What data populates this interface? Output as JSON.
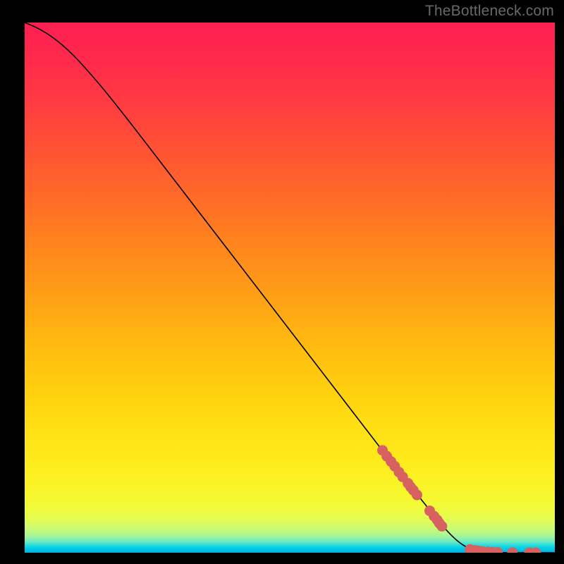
{
  "watermark": "TheBottleneck.com",
  "chart_data": {
    "type": "line",
    "title": "",
    "xlabel": "",
    "ylabel": "",
    "xlim": [
      0,
      100
    ],
    "ylim": [
      0,
      100
    ],
    "grid": false,
    "legend": false,
    "curve": [
      {
        "x": 0.0,
        "y": 100.0
      },
      {
        "x": 2.0,
        "y": 99.2
      },
      {
        "x": 4.0,
        "y": 98.1
      },
      {
        "x": 6.0,
        "y": 96.7
      },
      {
        "x": 8.0,
        "y": 95.0
      },
      {
        "x": 10.0,
        "y": 93.0
      },
      {
        "x": 12.0,
        "y": 90.8
      },
      {
        "x": 14.5,
        "y": 87.9
      },
      {
        "x": 17.0,
        "y": 84.8
      },
      {
        "x": 20.0,
        "y": 81.0
      },
      {
        "x": 25.0,
        "y": 74.5
      },
      {
        "x": 30.0,
        "y": 68.0
      },
      {
        "x": 35.0,
        "y": 61.5
      },
      {
        "x": 40.0,
        "y": 55.0
      },
      {
        "x": 45.0,
        "y": 48.5
      },
      {
        "x": 50.0,
        "y": 42.0
      },
      {
        "x": 55.0,
        "y": 35.5
      },
      {
        "x": 60.0,
        "y": 29.0
      },
      {
        "x": 65.0,
        "y": 22.5
      },
      {
        "x": 70.0,
        "y": 16.0
      },
      {
        "x": 75.0,
        "y": 9.8
      },
      {
        "x": 78.0,
        "y": 6.0
      },
      {
        "x": 80.5,
        "y": 3.2
      },
      {
        "x": 82.5,
        "y": 1.5
      },
      {
        "x": 84.5,
        "y": 0.5
      },
      {
        "x": 87.0,
        "y": 0.1
      },
      {
        "x": 90.0,
        "y": 0.0
      },
      {
        "x": 95.0,
        "y": 0.0
      },
      {
        "x": 100.0,
        "y": 0.0
      }
    ],
    "markers": [
      {
        "x": 67.5,
        "y": 19.3
      },
      {
        "x": 68.3,
        "y": 18.2
      },
      {
        "x": 69.1,
        "y": 17.2
      },
      {
        "x": 69.8,
        "y": 16.3
      },
      {
        "x": 70.6,
        "y": 15.2
      },
      {
        "x": 71.3,
        "y": 14.3
      },
      {
        "x": 72.3,
        "y": 13.1
      },
      {
        "x": 72.8,
        "y": 12.4
      },
      {
        "x": 73.3,
        "y": 11.8
      },
      {
        "x": 74.0,
        "y": 10.9
      },
      {
        "x": 76.4,
        "y": 7.9
      },
      {
        "x": 77.2,
        "y": 6.9
      },
      {
        "x": 77.8,
        "y": 6.2
      },
      {
        "x": 78.2,
        "y": 5.6
      },
      {
        "x": 78.7,
        "y": 5.0
      },
      {
        "x": 84.0,
        "y": 0.6
      },
      {
        "x": 84.9,
        "y": 0.45
      },
      {
        "x": 85.5,
        "y": 0.35
      },
      {
        "x": 86.3,
        "y": 0.25
      },
      {
        "x": 87.4,
        "y": 0.15
      },
      {
        "x": 88.2,
        "y": 0.1
      },
      {
        "x": 89.2,
        "y": 0.07
      },
      {
        "x": 92.0,
        "y": 0.02
      },
      {
        "x": 95.2,
        "y": 0.0
      },
      {
        "x": 96.4,
        "y": 0.0
      }
    ],
    "marker_color": "#d76161",
    "line_color": "#000000"
  }
}
